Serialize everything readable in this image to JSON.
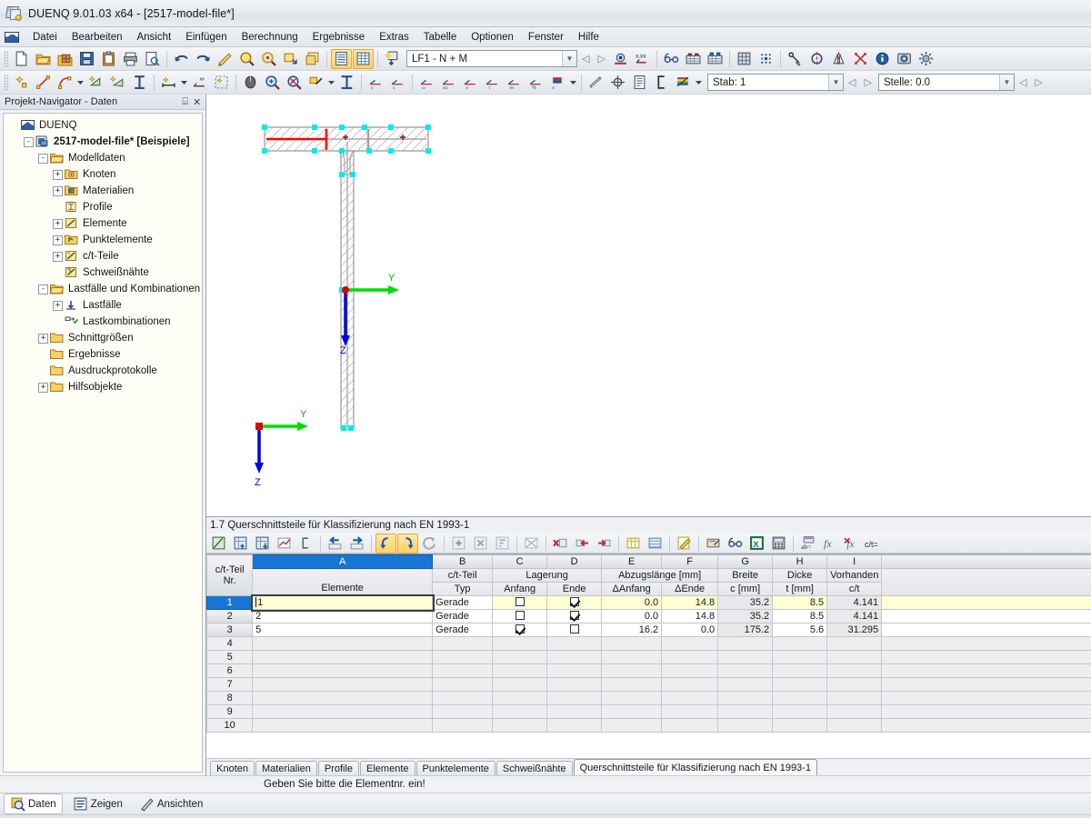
{
  "window": {
    "title": "DUENQ 9.01.03 x64 - [2517-model-file*]",
    "logo_icon": "duenq-app-icon"
  },
  "menu": {
    "app_icon": "duenq-menu-icon",
    "items": [
      {
        "label": "Datei",
        "accel": "D"
      },
      {
        "label": "Bearbeiten",
        "accel": "n"
      },
      {
        "label": "Ansicht",
        "accel": "A"
      },
      {
        "label": "Einfügen",
        "accel": "i"
      },
      {
        "label": "Berechnung",
        "accel": "r"
      },
      {
        "label": "Ergebnisse",
        "accel": "g"
      },
      {
        "label": "Extras",
        "accel": "E"
      },
      {
        "label": "Tabelle",
        "accel": "T"
      },
      {
        "label": "Optionen",
        "accel": "O"
      },
      {
        "label": "Fenster",
        "accel": "F"
      },
      {
        "label": "Hilfe",
        "accel": "H"
      }
    ]
  },
  "toolbar_main": {
    "icons": [
      "new-file-icon",
      "open-folder-icon",
      "open-package-icon",
      "save-icon",
      "clipboard-icon",
      "print-icon",
      "print-preview-icon",
      "undo-icon",
      "redo-icon",
      "edit-section-icon",
      "zoom-search-icon",
      "zoom-target-icon",
      "select-region-icon",
      "copy-window-icon",
      "table-list-icon",
      "table-grid-icon",
      "add-loadcase-icon"
    ],
    "loadcase_combo": {
      "value": "LF1 - N + M",
      "dropdown_icon": "chevron-down-icon"
    },
    "nav_prev_icon": "nav-prev-icon",
    "nav_next_icon": "nav-next-icon",
    "after_icons": [
      "render-view-icon",
      "x-xx-value-icon",
      "glasses-icon",
      "results-table-1-icon",
      "results-table-2-icon",
      "mesh-icon",
      "grid-points-icon",
      "node-snap-icon",
      "symmetry-circle-icon",
      "mirror-icon",
      "intersection-icon",
      "info-icon",
      "camera-icon",
      "settings-gear-icon"
    ]
  },
  "toolbar_second": {
    "icons": [
      "new-node-icon",
      "new-line-icon",
      "new-arc-icon",
      "dropdown-arc-icon",
      "new-element-icon",
      "new-element-2-icon",
      "new-profile-icon",
      "dimension-icon",
      "dropdown-dimension-icon",
      "xx-label-icon",
      "select-all-icon",
      "mouse-select-icon",
      "zoom-in-icon",
      "zoom-out-icon",
      "fill-icon",
      "dropdown-fill-icon",
      "i-section-icon",
      "su-icon",
      "sv-icon",
      "omega-icon",
      "s-omega-icon",
      "sigma-x-icon",
      "tau-icon",
      "sigma-v-icon",
      "percent-icon",
      "sigma-vpl-icon",
      "dropdown-sigma-icon",
      "measure-icon",
      "target-icon",
      "report-icon",
      "c-section-icon",
      "color-bar-icon",
      "dropdown-color-icon"
    ],
    "member_combo": {
      "label": "Stab: 1",
      "dropdown_icon": "chevron-down-icon"
    },
    "location_combo": {
      "label": "Stelle: 0.0",
      "dropdown_icon": "chevron-down-icon"
    },
    "nav_prev_icon": "nav-prev-icon",
    "nav_next_icon": "nav-next-icon"
  },
  "navigator": {
    "title": "Projekt-Navigator - Daten",
    "pin_icon": "pin-icon",
    "close_icon": "close-icon",
    "tree": [
      {
        "label": "DUENQ",
        "depth": 0,
        "icon": "duenq-root-icon",
        "expander": "",
        "bold": false
      },
      {
        "label": "2517-model-file* [Beispiele]",
        "depth": 1,
        "icon": "model-file-icon",
        "expander": "-",
        "bold": true
      },
      {
        "label": "Modelldaten",
        "depth": 2,
        "icon": "open-folder-icon",
        "expander": "-",
        "bold": false
      },
      {
        "label": "Knoten",
        "depth": 3,
        "icon": "node-folder-icon",
        "expander": "+",
        "bold": false
      },
      {
        "label": "Materialien",
        "depth": 3,
        "icon": "material-folder-icon",
        "expander": "+",
        "bold": false
      },
      {
        "label": "Profile",
        "depth": 3,
        "icon": "profile-folder-icon",
        "expander": "",
        "bold": false
      },
      {
        "label": "Elemente",
        "depth": 3,
        "icon": "element-folder-icon",
        "expander": "+",
        "bold": false
      },
      {
        "label": "Punktelemente",
        "depth": 3,
        "icon": "pointelement-folder-icon",
        "expander": "+",
        "bold": false
      },
      {
        "label": "c/t-Teile",
        "depth": 3,
        "icon": "ct-part-folder-icon",
        "expander": "+",
        "bold": false
      },
      {
        "label": "Schweißnähte",
        "depth": 3,
        "icon": "weld-folder-icon",
        "expander": "",
        "bold": false
      },
      {
        "label": "Lastfälle und Kombinationen",
        "depth": 2,
        "icon": "open-folder-icon",
        "expander": "-",
        "bold": false
      },
      {
        "label": "Lastfälle",
        "depth": 3,
        "icon": "loadcase-icon",
        "expander": "+",
        "bold": false
      },
      {
        "label": "Lastkombinationen",
        "depth": 3,
        "icon": "loadcombination-icon",
        "expander": "",
        "bold": false
      },
      {
        "label": "Schnittgrößen",
        "depth": 2,
        "icon": "folder-icon",
        "expander": "+",
        "bold": false
      },
      {
        "label": "Ergebnisse",
        "depth": 2,
        "icon": "folder-icon",
        "expander": "",
        "bold": false
      },
      {
        "label": "Ausdruckprotokolle",
        "depth": 2,
        "icon": "folder-icon",
        "expander": "",
        "bold": false
      },
      {
        "label": "Hilfsobjekte",
        "depth": 2,
        "icon": "folder-icon",
        "expander": "+",
        "bold": false
      }
    ]
  },
  "cadview": {
    "axis_y_label": "Y",
    "axis_z_label": "Z",
    "origin_axis_y_label": "Y",
    "origin_axis_z_label": "Z",
    "colors": {
      "axis_y": "#00dd00",
      "axis_z": "#0000e6",
      "origin_point": "#e00000",
      "node_marker": "#00f0f0",
      "highlight_element": "#ff0000",
      "hatch": "#888888"
    }
  },
  "table": {
    "title": "1.7 Querschnittsteile für Klassifizierung nach EN 1993-1",
    "toolbar_icons": [
      "edit-table-icon",
      "insert-row-icon",
      "import-rows-icon",
      "chart-table-icon",
      "bracket-icon",
      "prev-table-icon",
      "next-table-icon",
      "undo-table-icon",
      "redo-table-icon",
      "refresh-icon",
      "insert-cell-icon",
      "delete-cell-icon",
      "sort-cell-icon",
      "clear-selection-icon",
      "delete-row-icon",
      "remove-left-icon",
      "insert-right-icon",
      "column-colors-icon",
      "row-colors-icon",
      "edit-pencil-icon",
      "print-table-icon",
      "glasses-table-icon",
      "excel-export-icon",
      "calculator-icon",
      "ab-label-icon",
      "fx-icon",
      "fx-delete-icon",
      "ct-icon"
    ],
    "letter_headers": [
      "A",
      "B",
      "C",
      "D",
      "E",
      "F",
      "G",
      "H",
      "I"
    ],
    "selected_letter": "A",
    "group_headers": [
      {
        "label": "c/t-Teil\nNr.",
        "span": 1
      },
      {
        "label": "Elemente",
        "span": 1
      },
      {
        "label": "c/t-Teil",
        "sub": "Typ",
        "span": 1
      },
      {
        "label": "Lagerung",
        "subs": [
          "Anfang",
          "Ende"
        ],
        "span": 2
      },
      {
        "label": "Abzugslänge [mm]",
        "subs": [
          "ΔAnfang",
          "ΔEnde"
        ],
        "span": 2
      },
      {
        "label": "Breite",
        "sub": "c [mm]",
        "span": 1
      },
      {
        "label": "Dicke",
        "sub": "t [mm]",
        "span": 1
      },
      {
        "label": "Vorhanden",
        "sub": "c/t",
        "span": 1
      }
    ],
    "headers": {
      "rownr": "c/t-Teil",
      "rownr2": "Nr.",
      "elemente": "Elemente",
      "cttyp_1": "c/t-Teil",
      "cttyp_2": "Typ",
      "lagerung": "Lagerung",
      "lager_anfang": "Anfang",
      "lager_ende": "Ende",
      "abzug": "Abzugslänge [mm]",
      "abzug_anfang": "ΔAnfang",
      "abzug_ende": "ΔEnde",
      "breite": "Breite",
      "breite_unit": "c [mm]",
      "dicke": "Dicke",
      "dicke_unit": "t [mm]",
      "vorhanden": "Vorhanden",
      "vorhanden_unit": "c/t"
    },
    "rows": [
      {
        "nr": "1",
        "elemente": "1",
        "typ": "Gerade",
        "anfang": false,
        "ende": true,
        "d_anfang": "0.0",
        "d_ende": "14.8",
        "c": "35.2",
        "t": "8.5",
        "ct": "4.141",
        "selected": true,
        "editing": true
      },
      {
        "nr": "2",
        "elemente": "2",
        "typ": "Gerade",
        "anfang": false,
        "ende": true,
        "d_anfang": "0.0",
        "d_ende": "14.8",
        "c": "35.2",
        "t": "8.5",
        "ct": "4.141",
        "selected": false,
        "editing": false
      },
      {
        "nr": "3",
        "elemente": "5",
        "typ": "Gerade",
        "anfang": true,
        "ende": false,
        "d_anfang": "16.2",
        "d_ende": "0.0",
        "c": "175.2",
        "t": "5.6",
        "ct": "31.295",
        "selected": false,
        "editing": false
      }
    ],
    "empty_rows": [
      "4",
      "5",
      "6",
      "7",
      "8",
      "9",
      "10"
    ]
  },
  "tabs": {
    "items": [
      {
        "label": "Knoten",
        "active": false
      },
      {
        "label": "Materialien",
        "active": false
      },
      {
        "label": "Profile",
        "active": false
      },
      {
        "label": "Elemente",
        "active": false
      },
      {
        "label": "Punktelemente",
        "active": false
      },
      {
        "label": "Schweißnähte",
        "active": false
      },
      {
        "label": "Querschnittsteile für Klassifizierung nach EN 1993-1",
        "active": true
      }
    ]
  },
  "status": {
    "message": "Geben Sie bitte die Elementnr. ein!"
  },
  "bottombar": {
    "items": [
      {
        "label": "Daten",
        "icon": "data-icon",
        "active": true
      },
      {
        "label": "Zeigen",
        "icon": "show-icon",
        "active": false
      },
      {
        "label": "Ansichten",
        "icon": "views-icon",
        "active": false
      }
    ]
  }
}
